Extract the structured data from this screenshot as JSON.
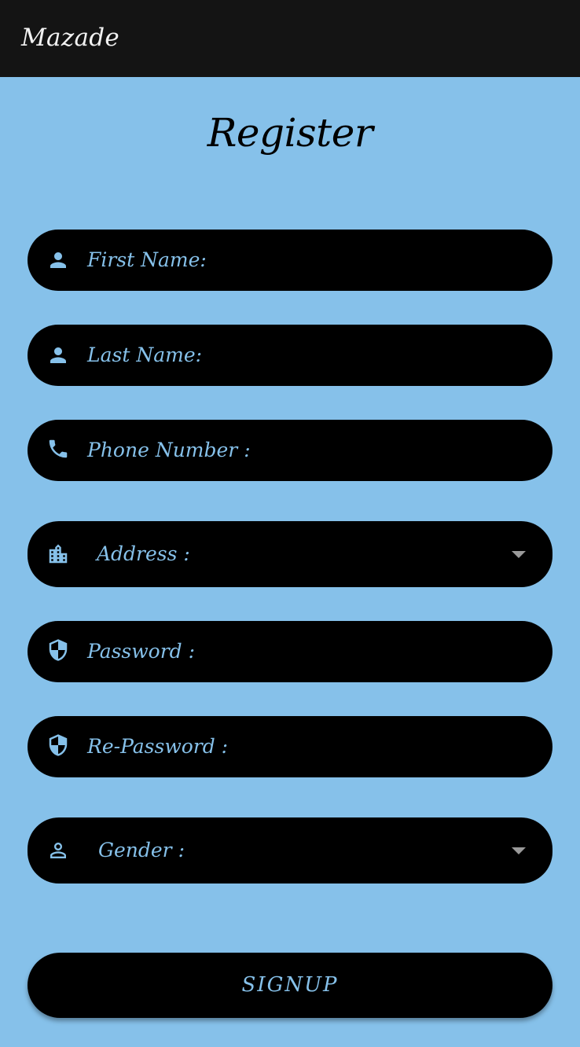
{
  "app": {
    "title": "Mazade"
  },
  "page": {
    "title": "Register"
  },
  "fields": {
    "first_name": {
      "label": "First Name:",
      "icon": "person-icon"
    },
    "last_name": {
      "label": "Last Name:",
      "icon": "person-icon"
    },
    "phone": {
      "label": "Phone Number :",
      "icon": "phone-icon"
    },
    "address": {
      "label": "Address :",
      "icon": "building-icon"
    },
    "password": {
      "label": "Password :",
      "icon": "shield-icon"
    },
    "re_password": {
      "label": "Re-Password :",
      "icon": "shield-icon"
    },
    "gender": {
      "label": "Gender :",
      "icon": "person-outline-icon"
    }
  },
  "actions": {
    "signup_label": "SIGNUP"
  },
  "colors": {
    "background": "#86c1ea",
    "appbar": "#141414",
    "field": "#000000",
    "accent": "#86c1ea"
  }
}
